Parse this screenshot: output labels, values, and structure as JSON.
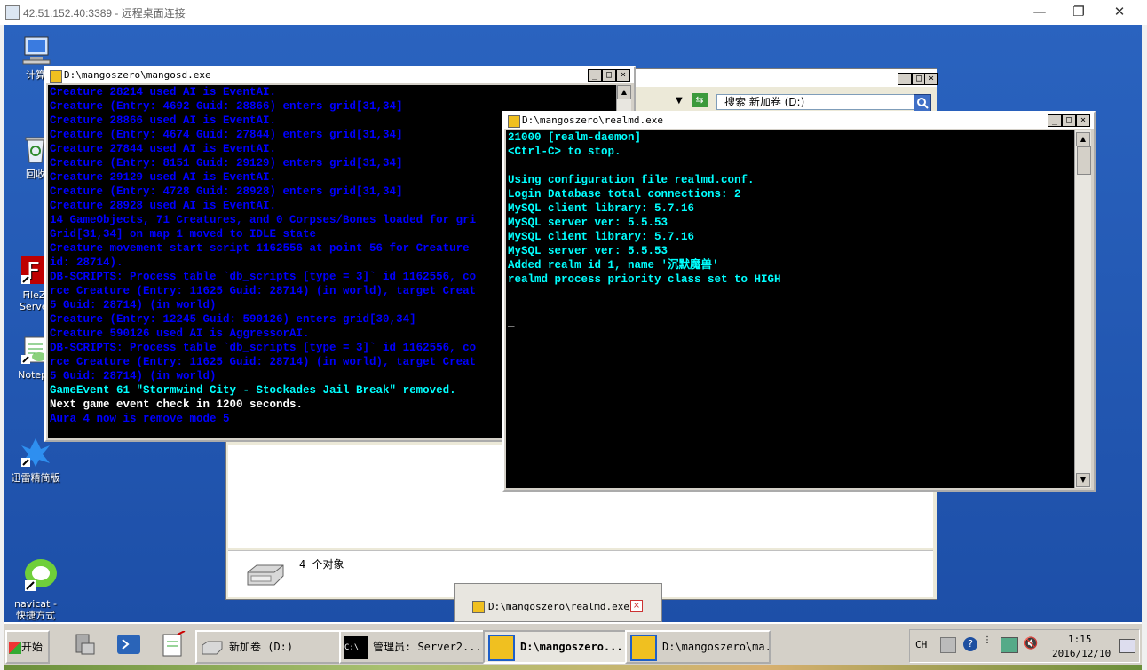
{
  "rdp": {
    "title": "42.51.152.40:3389 - 远程桌面连接",
    "min": "—",
    "max": "❐",
    "close": "✕"
  },
  "desktop_icons": [
    {
      "label": "计算",
      "icon": "computer-icon"
    },
    {
      "label": "回收",
      "icon": "recycle-bin-icon"
    },
    {
      "label": "FileZi\nServer",
      "icon": "filezilla-icon"
    },
    {
      "label": "Notepa",
      "icon": "notepad-icon"
    },
    {
      "label": "迅雷精简版",
      "icon": "thunder-icon"
    },
    {
      "label": "navicat -\n快捷方式",
      "icon": "navicat-icon"
    }
  ],
  "explorer": {
    "search": "搜索 新加卷 (D:)",
    "status": "4 个对象"
  },
  "mangosd": {
    "title": "D:\\mangoszero\\mangosd.exe",
    "lines": [
      {
        "t": "Creature 28214 used AI is EventAI.",
        "c": "#0000ff"
      },
      {
        "t": "Creature (Entry: 4692 Guid: 28866) enters grid[31,34]",
        "c": "#0000ff"
      },
      {
        "t": "Creature 28866 used AI is EventAI.",
        "c": "#0000ff"
      },
      {
        "t": "Creature (Entry: 4674 Guid: 27844) enters grid[31,34]",
        "c": "#0000ff"
      },
      {
        "t": "Creature 27844 used AI is EventAI.",
        "c": "#0000ff"
      },
      {
        "t": "Creature (Entry: 8151 Guid: 29129) enters grid[31,34]",
        "c": "#0000ff"
      },
      {
        "t": "Creature 29129 used AI is EventAI.",
        "c": "#0000ff"
      },
      {
        "t": "Creature (Entry: 4728 Guid: 28928) enters grid[31,34]",
        "c": "#0000ff"
      },
      {
        "t": "Creature 28928 used AI is EventAI.",
        "c": "#0000ff"
      },
      {
        "t": "14 GameObjects, 71 Creatures, and 0 Corpses/Bones loaded for gri",
        "c": "#0000ff"
      },
      {
        "t": "Grid[31,34] on map 1 moved to IDLE state",
        "c": "#0000ff"
      },
      {
        "t": "Creature movement start script 1162556 at point 56 for Creature",
        "c": "#0000ff"
      },
      {
        "t": "id: 28714).",
        "c": "#0000ff"
      },
      {
        "t": "DB-SCRIPTS: Process table `db_scripts [type = 3]` id 1162556, co",
        "c": "#0000ff"
      },
      {
        "t": "rce Creature (Entry: 11625 Guid: 28714) (in world), target Creat",
        "c": "#0000ff"
      },
      {
        "t": "5 Guid: 28714) (in world)",
        "c": "#0000ff"
      },
      {
        "t": "Creature (Entry: 12245 Guid: 590126) enters grid[30,34]",
        "c": "#0000ff"
      },
      {
        "t": "Creature 590126 used AI is AggressorAI.",
        "c": "#0000ff"
      },
      {
        "t": "DB-SCRIPTS: Process table `db_scripts [type = 3]` id 1162556, co",
        "c": "#0000ff"
      },
      {
        "t": "rce Creature (Entry: 11625 Guid: 28714) (in world), target Creat",
        "c": "#0000ff"
      },
      {
        "t": "5 Guid: 28714) (in world)",
        "c": "#0000ff"
      },
      {
        "t": "GameEvent 61 \"Stormwind City - Stockades Jail Break\" removed.",
        "c": "#00ffff"
      },
      {
        "t": "Next game event check in 1200 seconds.",
        "c": "#ffffff"
      },
      {
        "t": "Aura 4 now is remove mode 5",
        "c": "#0000ff"
      }
    ]
  },
  "realmd": {
    "title": "D:\\mangoszero\\realmd.exe",
    "lines": [
      {
        "t": "21000 [realm-daemon]",
        "c": "#00ffff"
      },
      {
        "t": "<Ctrl-C> to stop.",
        "c": "#00ffff"
      },
      {
        "t": "",
        "c": "#00ffff"
      },
      {
        "t": "Using configuration file realmd.conf.",
        "c": "#00ffff"
      },
      {
        "t": "Login Database total connections: 2",
        "c": "#00ffff"
      },
      {
        "t": "MySQL client library: 5.7.16",
        "c": "#00ffff"
      },
      {
        "t": "MySQL server ver: 5.5.53",
        "c": "#00ffff"
      },
      {
        "t": "MySQL client library: 5.7.16",
        "c": "#00ffff"
      },
      {
        "t": "MySQL server ver: 5.5.53",
        "c": "#00ffff"
      },
      {
        "t": "Added realm id 1, name '沉默魔兽'",
        "c": "#00ffff"
      },
      {
        "t": "realmd process priority class set to HIGH",
        "c": "#00ffff"
      },
      {
        "t": "",
        "c": "#00ffff"
      },
      {
        "t": "",
        "c": "#00ffff"
      },
      {
        "t": "_",
        "c": "#c0c0c0"
      }
    ]
  },
  "tooltip": {
    "text": "D:\\mangoszero\\realmd.exe"
  },
  "taskbar": {
    "start": "开始",
    "buttons": [
      {
        "label": "新加卷 (D:)",
        "icon": "drive-icon"
      },
      {
        "label": "管理员:  Server2...",
        "icon": "cmd-icon"
      },
      {
        "label": "D:\\mangoszero...",
        "icon": "mangos-icon"
      },
      {
        "label": "D:\\mangoszero\\ma...",
        "icon": "mangos-icon"
      }
    ],
    "lang": "CH",
    "time": "1:15",
    "date": "2016/12/10"
  }
}
